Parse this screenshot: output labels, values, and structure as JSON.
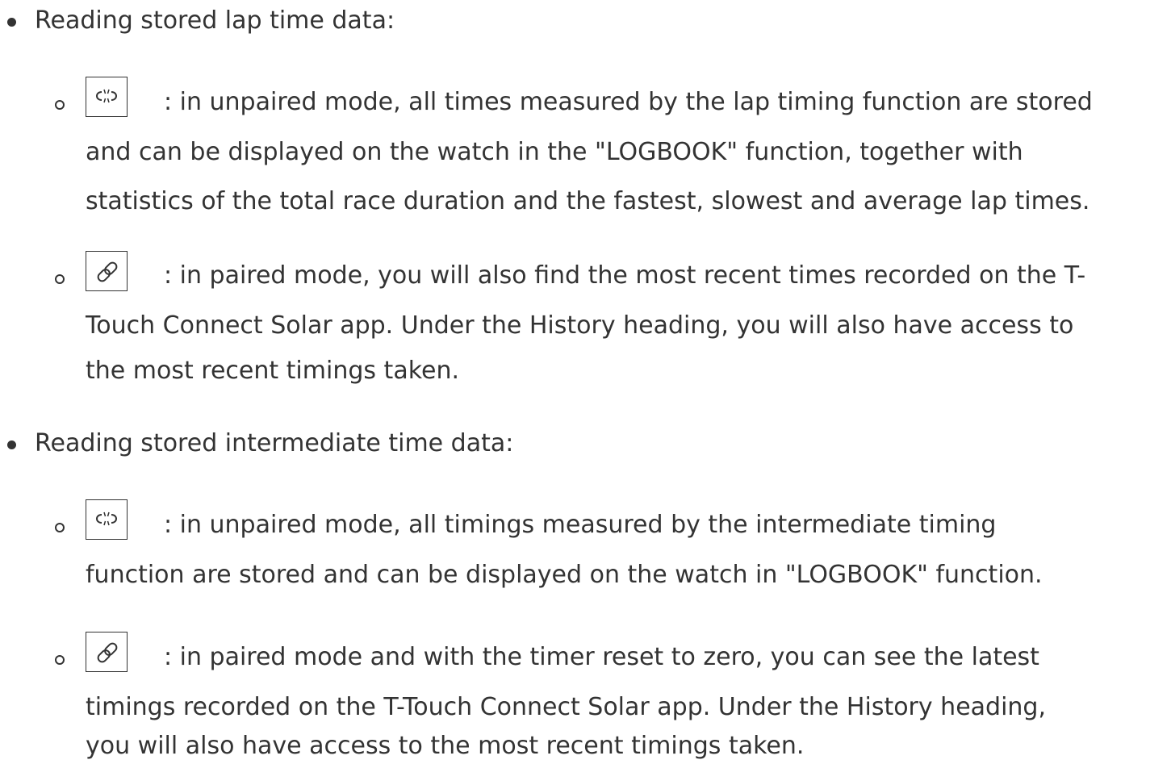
{
  "sections": [
    {
      "heading": "Reading stored lap time data:",
      "items": [
        {
          "icon": "unlink-icon",
          "lines": [
            ": in unpaired mode, all times measured by the lap timing function are stored",
            "and can be displayed on the watch in the \"LOGBOOK\" function, together with",
            "statistics of the total race duration and the fastest, slowest and average lap times."
          ]
        },
        {
          "icon": "link-icon",
          "lines": [
            ": in paired mode, you will also find the most recent times recorded on the T-",
            "Touch Connect Solar app. Under the History heading, you will also have access to",
            "the most recent timings taken."
          ]
        }
      ]
    },
    {
      "heading": "Reading stored intermediate time data:",
      "items": [
        {
          "icon": "unlink-icon",
          "lines": [
            ": in unpaired mode, all timings measured by the intermediate timing",
            "function are stored and can be displayed on the watch in \"LOGBOOK\" function."
          ]
        },
        {
          "icon": "link-icon",
          "lines": [
            ": in paired mode and with the timer reset to zero, you can see the latest",
            "timings recorded on the T-Touch Connect Solar app. Under the History heading,",
            "you will also have access to the most recent timings taken."
          ]
        }
      ]
    }
  ]
}
